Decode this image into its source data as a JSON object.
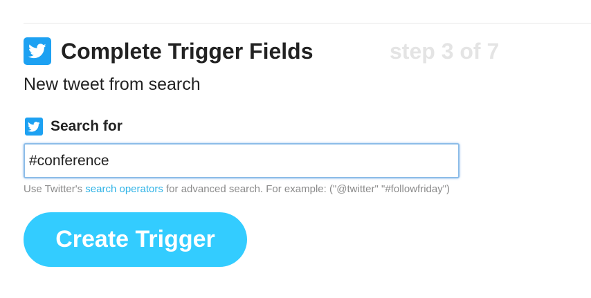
{
  "header": {
    "title": "Complete Trigger Fields",
    "step": "step 3 of 7",
    "icon": "twitter-icon"
  },
  "subtitle": "New tweet from search",
  "field": {
    "label": "Search for",
    "icon": "twitter-icon",
    "value": "#conference"
  },
  "help": {
    "prefix": "Use Twitter's",
    "link": "search operators",
    "suffix": "for advanced search. For example: (\"@twitter\" \"#followfriday\")"
  },
  "button": {
    "label": "Create Trigger"
  },
  "colors": {
    "accent": "#33ccff",
    "twitter": "#1da1f2",
    "link": "#2fb3e6"
  }
}
